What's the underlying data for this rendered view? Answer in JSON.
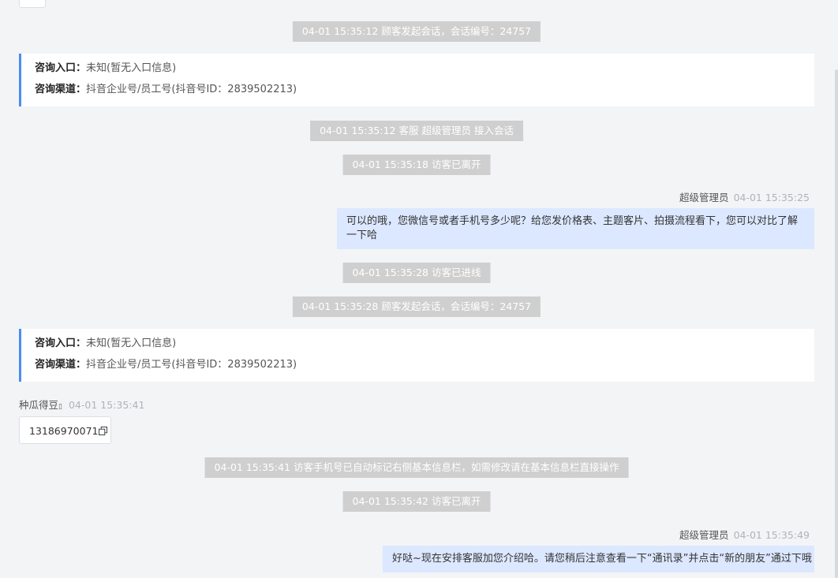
{
  "events": {
    "e1": "04-01 15:35:12 顾客发起会话，会话编号：24757",
    "e2": "04-01 15:35:12 客服 超级管理员 接入会话",
    "e3": "04-01 15:35:18 访客已离开",
    "e4": "04-01 15:35:28 访客已进线",
    "e5": "04-01 15:35:28 顾客发起会话，会话编号：24757",
    "e6": "04-01 15:35:41 访客手机号已自动标记右侧基本信息栏，如需修改请在基本信息栏直接操作",
    "e7": "04-01 15:35:42 访客已离开"
  },
  "info_card_1": {
    "entry_label": "咨询入口：",
    "entry_value": "未知(暂无入口信息)",
    "channel_label": "咨询渠道：",
    "channel_value": "抖音企业号/员工号(抖音号ID：2839502213)"
  },
  "info_card_2": {
    "entry_label": "咨询入口：",
    "entry_value": "未知(暂无入口信息)",
    "channel_label": "咨询渠道：",
    "channel_value": "抖音企业号/员工号(抖音号ID：2839502213)"
  },
  "msg_agent_1": {
    "name": "超级管理员",
    "time": "04-01 15:35:25",
    "text_line1": "可以的哦，您微信号或者手机号多少呢？给您发价格表、主题客片、拍摄流程看下，您可以对比了解",
    "text_line2": "一下哈"
  },
  "msg_visitor_1": {
    "name": "种瓜得豆",
    "name_suffix": "▯",
    "time": "04-01 15:35:41",
    "text": "13186970071"
  },
  "msg_agent_2": {
    "name": "超级管理员",
    "time": "04-01 15:35:49",
    "text": "好哒~现在安排客服加您介绍哈。请您稍后注意查看一下“通讯录”并点击“新的朋友”通过下哦"
  },
  "icons": {
    "copy": "copy-icon"
  },
  "colors": {
    "accent": "#4a8cf5",
    "agent_bubble": "#dce8ff",
    "system_pill": "#cfcfcf",
    "background": "#f3f4f6"
  }
}
